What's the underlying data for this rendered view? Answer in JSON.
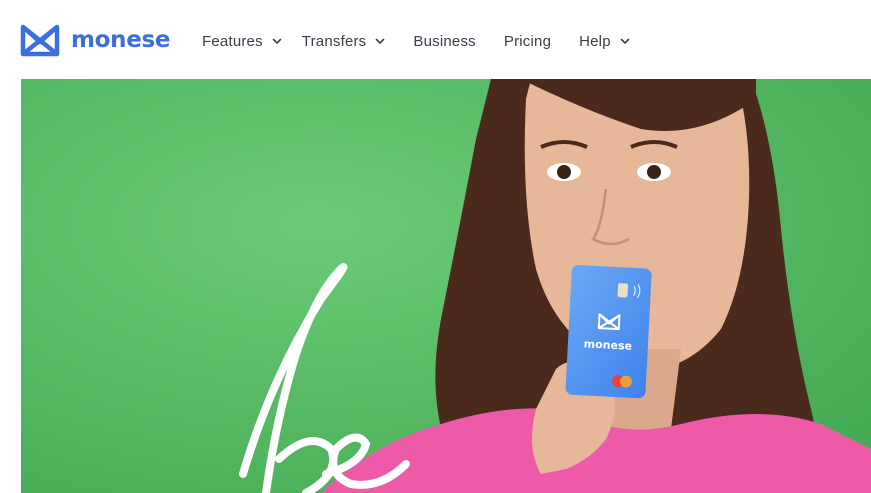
{
  "brand": {
    "name": "monese",
    "logo_icon": "monese-m-logo",
    "color": "#3b6fe0"
  },
  "nav": {
    "items": [
      {
        "label": "Features",
        "has_dropdown": true
      },
      {
        "label": "Transfers",
        "has_dropdown": true
      },
      {
        "label": "Business",
        "has_dropdown": false
      },
      {
        "label": "Pricing",
        "has_dropdown": false
      },
      {
        "label": "Help",
        "has_dropdown": true
      }
    ]
  },
  "hero": {
    "background_color": "#5cc26a",
    "script_text": "be",
    "card": {
      "brand_text": "monese",
      "color": "#4a8ff0"
    }
  }
}
